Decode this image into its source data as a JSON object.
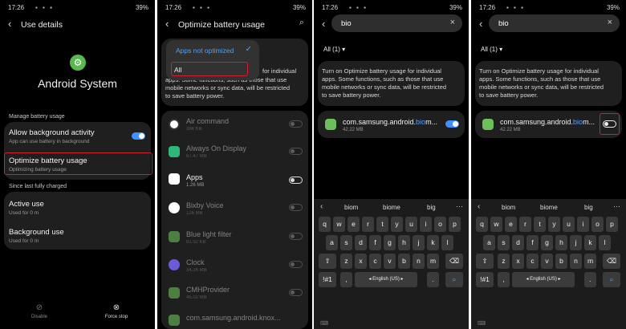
{
  "status": {
    "time": "17:26",
    "battery": "39%"
  },
  "screen1": {
    "title": "Use details",
    "app_name": "Android System",
    "section_manage": "Manage battery usage",
    "allow_bg_title": "Allow background activity",
    "allow_bg_sub": "App can use battery in background",
    "optimize_title": "Optimize battery usage",
    "optimize_sub": "Optimizing battery usage",
    "section_since": "Since last fully charged",
    "active_title": "Active use",
    "active_sub": "Used for 0 m",
    "background_title": "Background use",
    "background_sub": "Used for 0 m",
    "disable_label": "Disable",
    "forcestop_label": "Force stop"
  },
  "screen2": {
    "title": "Optimize battery usage",
    "dropdown_selected": "Apps not optimized",
    "dropdown_option": "All",
    "desc_partial_1": "apps. Some functions, such as those that use",
    "desc_partial_2": "mobile networks or sync data, will be restricted",
    "desc_partial_3": "to save battery power.",
    "desc_partial_0": "for individual",
    "apps": [
      {
        "name": "Air command",
        "size": "386 KB",
        "dim": true
      },
      {
        "name": "Always On Display",
        "size": "67.47 MB",
        "dim": true
      },
      {
        "name": "Apps",
        "size": "1.26 MB",
        "dim": false
      },
      {
        "name": "Bixby Voice",
        "size": "126 MB",
        "dim": true
      },
      {
        "name": "Blue light filter",
        "size": "81.92 KB",
        "dim": true
      },
      {
        "name": "Clock",
        "size": "34.26 MB",
        "dim": true
      },
      {
        "name": "CMHProvider",
        "size": "45.02 MB",
        "dim": true
      },
      {
        "name": "com.samsung.android.knox...",
        "size": "",
        "dim": true
      }
    ]
  },
  "screen3": {
    "search_value": "bio",
    "filter": "All (1)",
    "desc_1": "Turn on Optimize battery usage for individual",
    "desc_2": "apps. Some functions, such as those that use",
    "desc_3": "mobile networks or sync data, will be restricted",
    "desc_4": "to save battery power.",
    "app_name_pre": "com.samsung.android.",
    "app_name_hl": "bio",
    "app_name_post": "m...",
    "app_size": "42.22 MB",
    "suggestions": [
      "biom",
      "biome",
      "big"
    ],
    "row1": [
      "q",
      "w",
      "e",
      "r",
      "t",
      "y",
      "u",
      "i",
      "o",
      "p"
    ],
    "row2": [
      "a",
      "s",
      "d",
      "f",
      "g",
      "h",
      "j",
      "k",
      "l"
    ],
    "row3": [
      "z",
      "x",
      "c",
      "v",
      "b",
      "n",
      "m"
    ],
    "symbols_key": "!#1",
    "comma_key": ",",
    "space_label": "English (US)",
    "period_key": "."
  },
  "colors": {
    "accent": "#3e91ff",
    "highlight": "#d21f2a"
  }
}
